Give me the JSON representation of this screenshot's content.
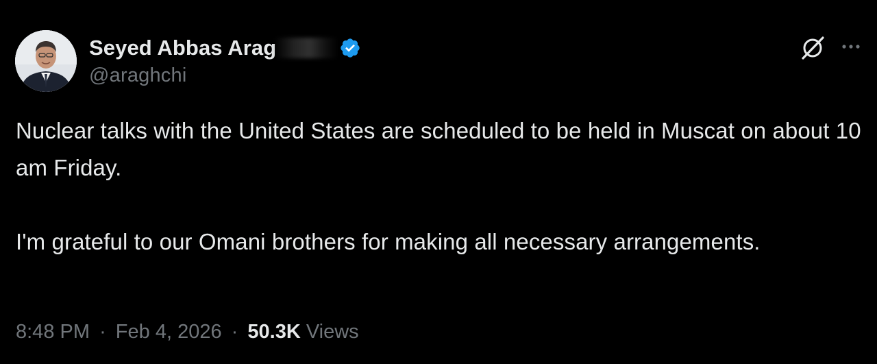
{
  "author": {
    "display_name": "Seyed Abbas Arag",
    "handle": "@araghchi",
    "verified": true,
    "avatar_icon": "profile-photo-icon"
  },
  "actions": {
    "grok_icon": "grok-icon",
    "more_icon": "more-options-icon"
  },
  "tweet": {
    "paragraphs": [
      "Nuclear talks with the United States are scheduled to be held in Muscat on about 10 am Friday.",
      "I'm grateful to our Omani brothers for making all necessary arrangements."
    ]
  },
  "meta": {
    "time": "8:48 PM",
    "separator": "·",
    "date": "Feb 4, 2026",
    "views_count": "50.3K",
    "views_label": "Views"
  },
  "colors": {
    "background": "#000000",
    "primary_text": "#e7e9ea",
    "secondary_text": "#71767b",
    "verified_blue": "#1d9bf0"
  }
}
